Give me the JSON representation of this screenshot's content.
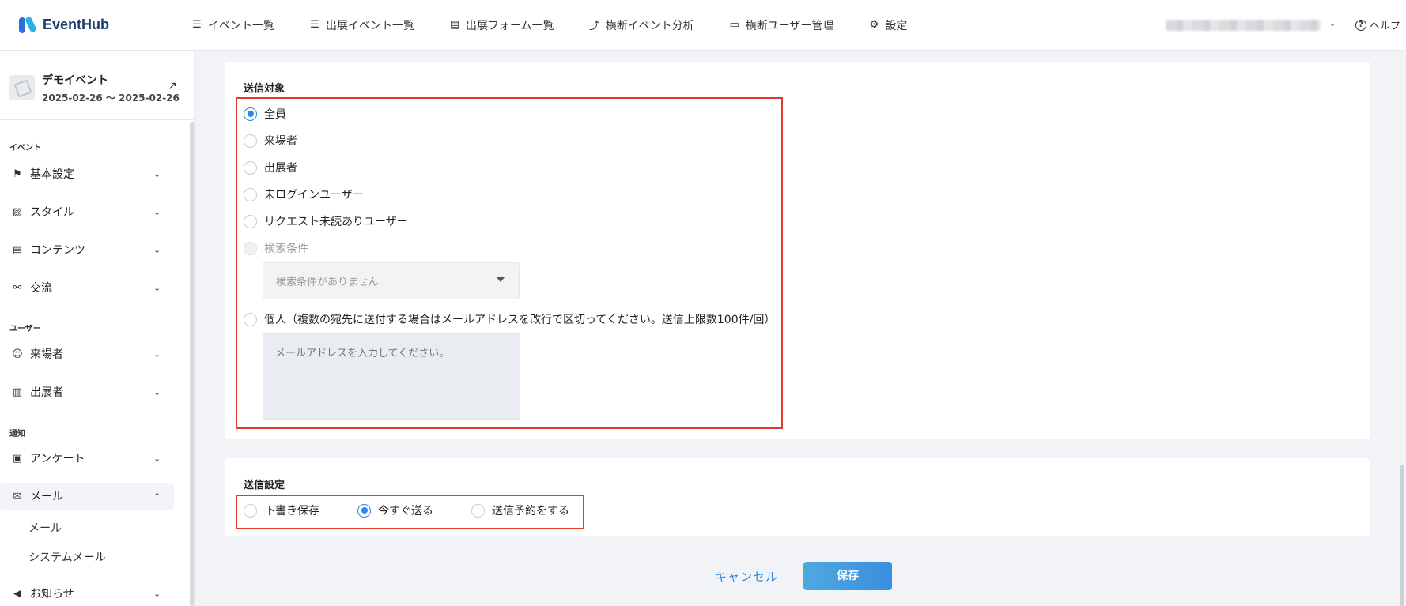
{
  "app": {
    "name": "EventHub"
  },
  "nav": [
    {
      "label": "イベント一覧",
      "icon": "list-icon"
    },
    {
      "label": "出展イベント一覧",
      "icon": "list-icon"
    },
    {
      "label": "出展フォーム一覧",
      "icon": "document-icon"
    },
    {
      "label": "横断イベント分析",
      "icon": "chart-icon"
    },
    {
      "label": "横断ユーザー管理",
      "icon": "id-card-icon"
    },
    {
      "label": "設定",
      "icon": "gear-icon"
    }
  ],
  "help_label": "ヘルプ",
  "event": {
    "name": "デモイベント",
    "dates": "2025-02-26 〜 2025-02-26"
  },
  "sidebar": {
    "sections": [
      {
        "label": "イベント"
      },
      {
        "label": "ユーザー"
      },
      {
        "label": "通知"
      }
    ],
    "items": [
      {
        "label": "基本設定",
        "icon": "flag-icon"
      },
      {
        "label": "スタイル",
        "icon": "image-icon"
      },
      {
        "label": "コンテンツ",
        "icon": "list-icon"
      },
      {
        "label": "交流",
        "icon": "handshake-icon"
      },
      {
        "label": "来場者",
        "icon": "user-icon"
      },
      {
        "label": "出展者",
        "icon": "building-icon"
      },
      {
        "label": "アンケート",
        "icon": "clipboard-icon"
      },
      {
        "label": "メール",
        "icon": "mail-icon",
        "expanded": true
      },
      {
        "label": "お知らせ",
        "icon": "megaphone-icon"
      }
    ],
    "sub_items": [
      {
        "label": "メール"
      },
      {
        "label": "システムメール"
      }
    ]
  },
  "recipients": {
    "title": "送信対象",
    "options": [
      {
        "label": "全員",
        "checked": true
      },
      {
        "label": "来場者",
        "checked": false
      },
      {
        "label": "出展者",
        "checked": false
      },
      {
        "label": "未ログインユーザー",
        "checked": false
      },
      {
        "label": "リクエスト未読ありユーザー",
        "checked": false
      },
      {
        "label": "検索条件",
        "checked": false,
        "disabled": true
      },
      {
        "label": "個人（複数の宛先に送付する場合はメールアドレスを改行で区切ってください。送信上限数100件/回）",
        "checked": false
      }
    ],
    "search_select_value": "検索条件がありません",
    "email_placeholder": "メールアドレスを入力してください。"
  },
  "send_settings": {
    "title": "送信設定",
    "options": [
      {
        "label": "下書き保存",
        "checked": false
      },
      {
        "label": "今すぐ送る",
        "checked": true
      },
      {
        "label": "送信予約をする",
        "checked": false
      }
    ]
  },
  "actions": {
    "cancel": "キャンセル",
    "save": "保存"
  },
  "colors": {
    "accent": "#2f86e6",
    "highlight": "#e23a2a",
    "brand": "#1d3c6e"
  }
}
